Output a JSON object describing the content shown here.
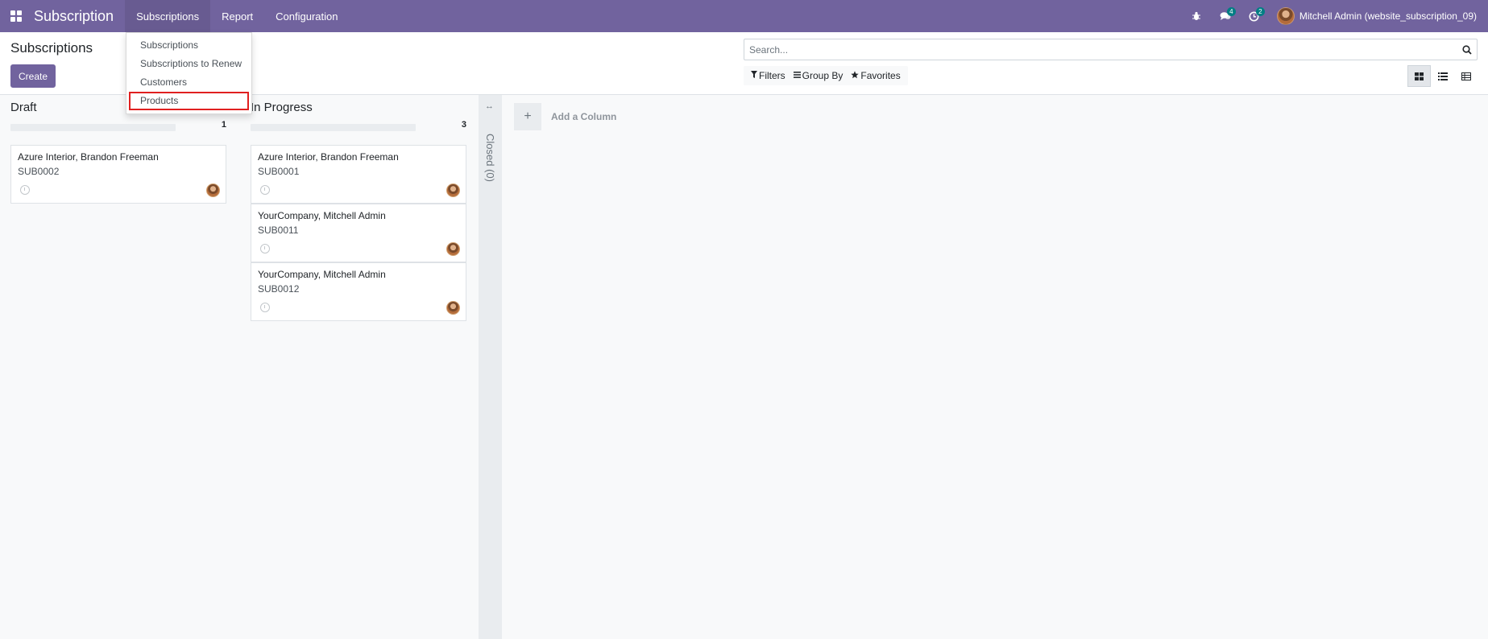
{
  "navbar": {
    "app_name": "Subscription",
    "menu": [
      "Subscriptions",
      "Report",
      "Configuration"
    ],
    "chat_count": "4",
    "activity_count": "2",
    "user_name": "Mitchell Admin (website_subscription_09)"
  },
  "dropdown": {
    "items": [
      "Subscriptions",
      "Subscriptions to Renew",
      "Customers",
      "Products"
    ]
  },
  "control": {
    "title": "Subscriptions",
    "create_label": "Create",
    "search_placeholder": "Search...",
    "filters_label": "Filters",
    "groupby_label": "Group By",
    "favorites_label": "Favorites"
  },
  "kanban": {
    "columns": [
      {
        "name": "Draft",
        "count": "1",
        "cards": [
          {
            "title": "Azure Interior, Brandon Freeman",
            "ref": "SUB0002"
          }
        ]
      },
      {
        "name": "In Progress",
        "count": "3",
        "cards": [
          {
            "title": "Azure Interior, Brandon Freeman",
            "ref": "SUB0001"
          },
          {
            "title": "YourCompany, Mitchell Admin",
            "ref": "SUB0011"
          },
          {
            "title": "YourCompany, Mitchell Admin",
            "ref": "SUB0012"
          }
        ]
      }
    ],
    "folded_column": "Closed (0)",
    "add_column_label": "Add a Column"
  },
  "colors": {
    "brand": "#71639e",
    "badge": "#017e84",
    "highlight": "#e02020"
  }
}
